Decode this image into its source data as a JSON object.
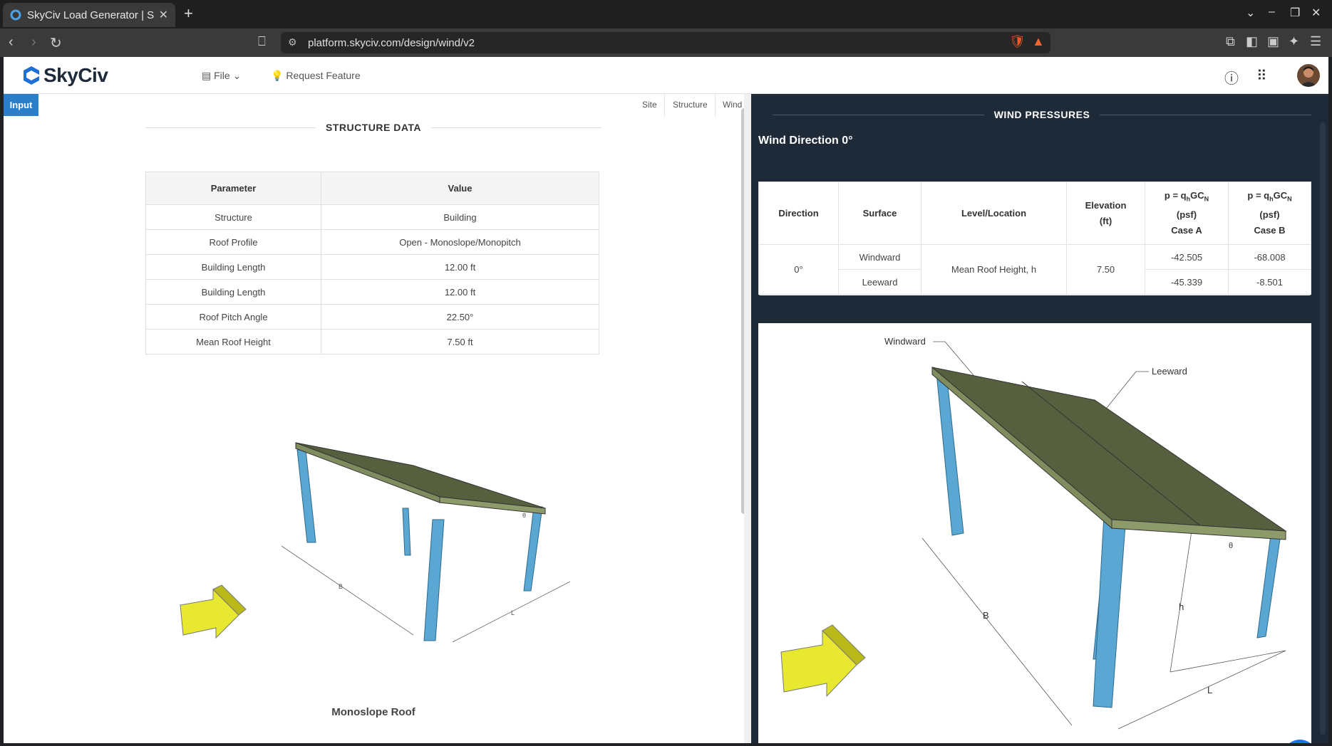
{
  "browser": {
    "tab_title": "SkyCiv Load Generator | S",
    "tab_close": "✕",
    "new_tab": "+",
    "url": "platform.skyciv.com/design/wind/v2"
  },
  "header": {
    "logo": "SkyCiv",
    "file_menu": "File",
    "request_feature": "Request Feature"
  },
  "left": {
    "input_tab": "Input",
    "subtabs": [
      "Site",
      "Structure",
      "Wind"
    ],
    "section_title": "STRUCTURE DATA",
    "table": {
      "headers": [
        "Parameter",
        "Value"
      ],
      "rows": [
        [
          "Structure",
          "Building"
        ],
        [
          "Roof Profile",
          "Open - Monoslope/Monopitch"
        ],
        [
          "Building Length",
          "12.00 ft"
        ],
        [
          "Building Length",
          "12.00 ft"
        ],
        [
          "Roof Pitch Angle",
          "22.50°"
        ],
        [
          "Mean Roof Height",
          "7.50 ft"
        ]
      ]
    },
    "figure_caption": "Monoslope Roof",
    "figure_labels": {
      "b": "B",
      "l": "L",
      "theta": "θ"
    }
  },
  "right": {
    "section_title": "WIND PRESSURES",
    "wind_direction": "Wind Direction 0°",
    "table": {
      "headers": {
        "direction": "Direction",
        "surface": "Surface",
        "level": "Level/Location",
        "elevation": "Elevation",
        "elevation_unit": "(ft)",
        "p_label": "p = q",
        "p_sub_h": "h",
        "p_gc": "GC",
        "p_sub_n": "N",
        "psf": "(psf)",
        "case_a": "Case A",
        "case_b": "Case B"
      },
      "direction": "0°",
      "level": "Mean Roof Height, h",
      "elevation": "7.50",
      "rows": [
        {
          "surface": "Windward",
          "case_a": "-42.505",
          "case_b": "-68.008"
        },
        {
          "surface": "Leeward",
          "case_a": "-45.339",
          "case_b": "-8.501"
        }
      ]
    },
    "figure_labels": {
      "windward": "Windward",
      "leeward": "Leeward",
      "b": "B",
      "l": "L",
      "h": "h",
      "theta": "θ"
    }
  },
  "colors": {
    "accent": "#2b7fc8",
    "dark_panel": "#1e2a38",
    "roof": "#5a6a44",
    "column": "#4f9cc8",
    "arrow": "#e6e62a"
  }
}
